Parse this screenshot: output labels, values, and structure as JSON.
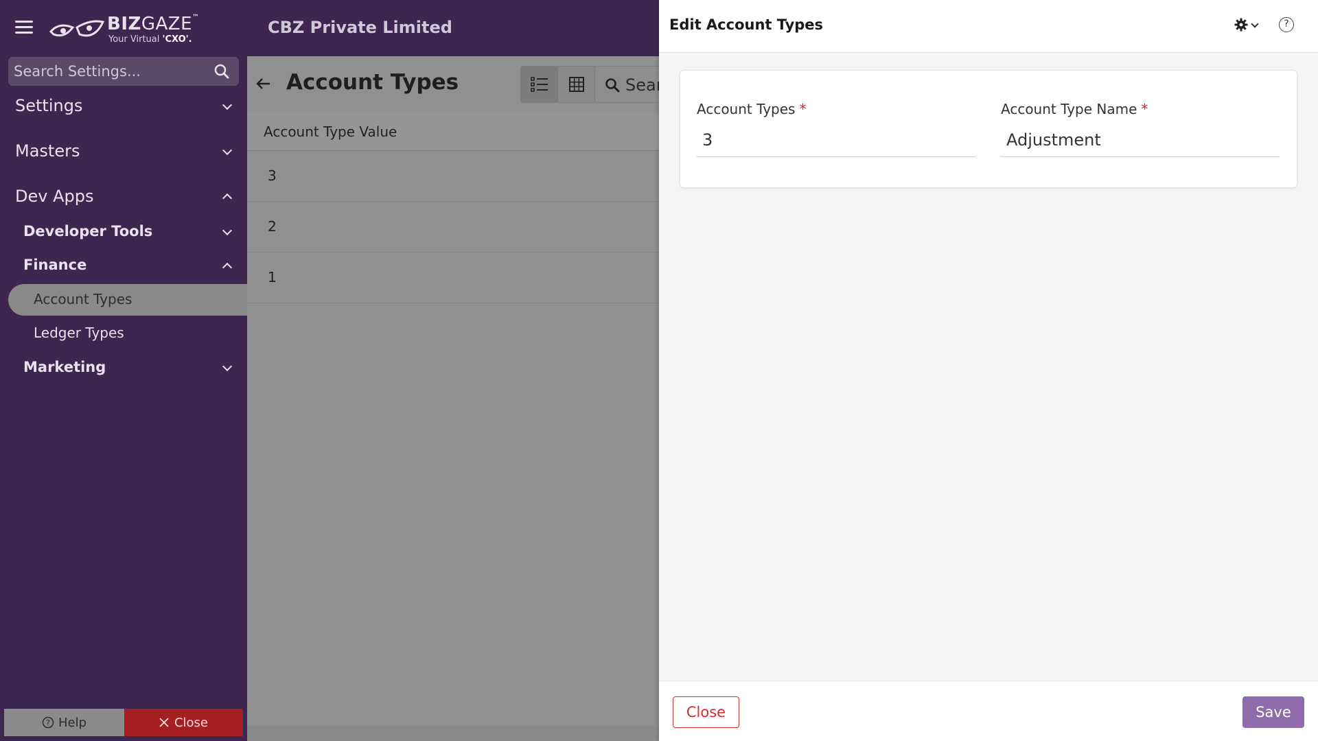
{
  "brand": {
    "name_bold": "BIZ",
    "name_thin": "GAZE",
    "tm": "™",
    "tagline_prefix": "Your Virtual",
    "tagline_bold": "'CXO'."
  },
  "sidebar": {
    "search_placeholder": "Search Settings...",
    "groups": [
      {
        "label": "Settings"
      },
      {
        "label": "Masters"
      },
      {
        "label": "Dev Apps"
      }
    ],
    "subgroups": [
      {
        "label": "Developer Tools"
      },
      {
        "label": "Finance"
      },
      {
        "label": "Marketing"
      }
    ],
    "items": [
      {
        "label": "Account Types"
      },
      {
        "label": "Ledger Types"
      }
    ],
    "help_label": "Help",
    "close_label": "Close"
  },
  "header": {
    "company": "CBZ Private Limited"
  },
  "main": {
    "title": "Account Types",
    "search_placeholder": "Search",
    "grid": {
      "column": "Account Type Value",
      "rows": [
        "3",
        "2",
        "1"
      ]
    }
  },
  "drawer": {
    "title": "Edit Account Types",
    "help_glyph": "?",
    "fields": [
      {
        "label": "Account Types",
        "required": "*",
        "value": "3"
      },
      {
        "label": "Account Type Name",
        "required": "*",
        "value": "Adjustment"
      }
    ],
    "close_label": "Close",
    "save_label": "Save"
  },
  "colors": {
    "sidebar_bg": "#3d2650",
    "accent_save": "#8f6bab",
    "danger": "#d82a2f"
  }
}
